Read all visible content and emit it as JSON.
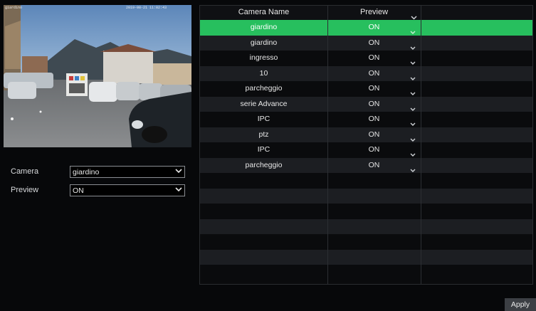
{
  "preview": {
    "osd_name": "giardino",
    "osd_time": "2019-08-21 11:02:43"
  },
  "form": {
    "camera_label": "Camera",
    "camera_value": "giardino",
    "preview_label": "Preview",
    "preview_value": "ON"
  },
  "table": {
    "headers": {
      "name": "Camera Name",
      "preview": "Preview"
    },
    "rows": [
      {
        "name": "giardino",
        "preview": "ON"
      },
      {
        "name": "giardino",
        "preview": "ON"
      },
      {
        "name": "ingresso",
        "preview": "ON"
      },
      {
        "name": "10",
        "preview": "ON"
      },
      {
        "name": "parcheggio",
        "preview": "ON"
      },
      {
        "name": "serie Advance",
        "preview": "ON"
      },
      {
        "name": "IPC",
        "preview": "ON"
      },
      {
        "name": "ptz",
        "preview": "ON"
      },
      {
        "name": "IPC",
        "preview": "ON"
      },
      {
        "name": "parcheggio",
        "preview": "ON"
      }
    ]
  },
  "apply_label": "Apply",
  "colors": {
    "selected_row": "#27bf5e",
    "background": "#07080a"
  }
}
